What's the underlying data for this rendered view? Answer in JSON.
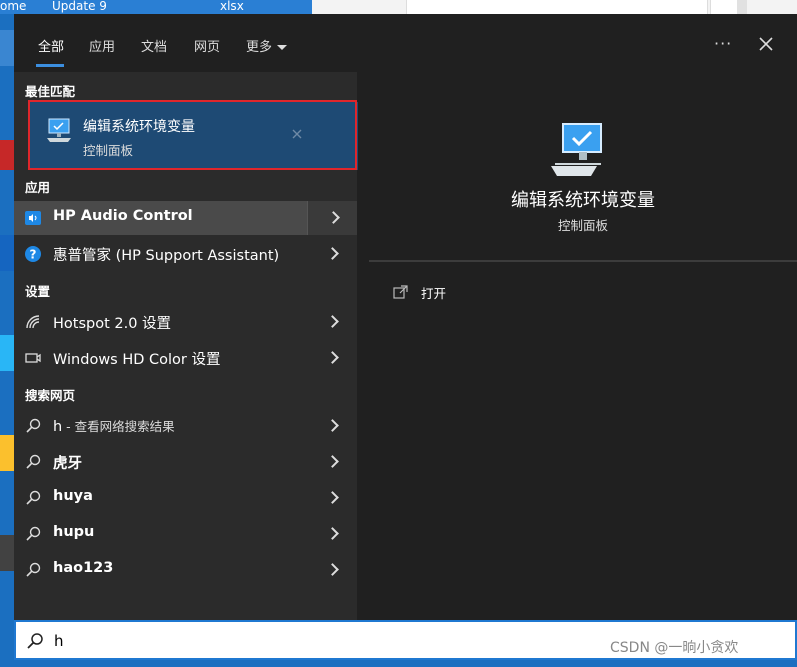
{
  "desktop": {
    "strip_texts": [
      "ome",
      "Update 9",
      "xlsx"
    ]
  },
  "nav": {
    "tabs": [
      {
        "label": "全部",
        "active": true
      },
      {
        "label": "应用"
      },
      {
        "label": "文档"
      },
      {
        "label": "网页"
      },
      {
        "label": "更多"
      }
    ],
    "ellipsis": "···"
  },
  "sections": {
    "best_match": "最佳匹配",
    "apps": "应用",
    "settings": "设置",
    "web": "搜索网页"
  },
  "best_match": {
    "title": "编辑系统环境变量",
    "subtitle": "控制面板",
    "icon": "monitor-settings-icon"
  },
  "apps": [
    {
      "label": "HP Audio Control",
      "icon": "hp-audio-icon"
    },
    {
      "label": "惠普管家 (HP Support Assistant)",
      "icon": "help-question-icon"
    }
  ],
  "settings": [
    {
      "label": "Hotspot 2.0 设置",
      "icon": "wifi-signal-icon"
    },
    {
      "label": "Windows HD Color 设置",
      "icon": "display-icon"
    }
  ],
  "web": [
    {
      "query": "h",
      "suffix": " - 查看网络搜索结果"
    },
    {
      "query": "虎牙",
      "suffix": ""
    },
    {
      "query": "huya",
      "suffix": ""
    },
    {
      "query": "hupu",
      "suffix": ""
    },
    {
      "query": "hao123",
      "suffix": ""
    }
  ],
  "preview": {
    "title": "编辑系统环境变量",
    "subtitle": "控制面板",
    "action_open": "打开"
  },
  "search": {
    "value": "h"
  },
  "watermark": "CSDN @一晌小贪欢",
  "colors": {
    "accent": "#3c8fe0",
    "selection_border": "#e0262b",
    "best_bg": "#1e4a74"
  }
}
